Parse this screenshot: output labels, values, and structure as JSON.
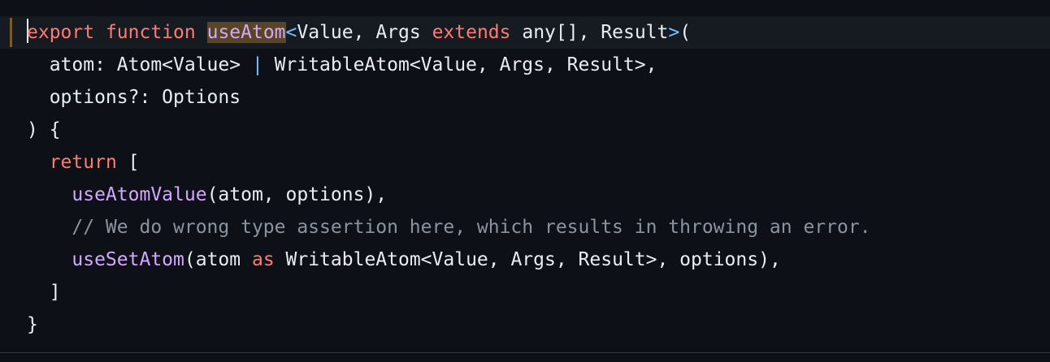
{
  "editor": {
    "lines": [
      {
        "tokens": [
          {
            "text": "export",
            "type": "keyword"
          },
          {
            "text": " ",
            "type": "plain"
          },
          {
            "text": "function",
            "type": "keyword"
          },
          {
            "text": " ",
            "type": "plain"
          },
          {
            "text": "useAtom",
            "type": "function-highlighted"
          },
          {
            "text": "<",
            "type": "operator"
          },
          {
            "text": "Value, Args ",
            "type": "plain"
          },
          {
            "text": "extends",
            "type": "keyword"
          },
          {
            "text": " any[], Result",
            "type": "plain"
          },
          {
            "text": ">",
            "type": "operator"
          },
          {
            "text": "(",
            "type": "plain"
          }
        ]
      },
      {
        "tokens": [
          {
            "text": "  atom: Atom<Value> ",
            "type": "plain"
          },
          {
            "text": "|",
            "type": "operator"
          },
          {
            "text": " WritableAtom<Value, Args, Result>,",
            "type": "plain"
          }
        ]
      },
      {
        "tokens": [
          {
            "text": "  options?: Options",
            "type": "plain"
          }
        ]
      },
      {
        "tokens": [
          {
            "text": ") {",
            "type": "plain"
          }
        ]
      },
      {
        "tokens": [
          {
            "text": "  ",
            "type": "plain"
          },
          {
            "text": "return",
            "type": "keyword"
          },
          {
            "text": " [",
            "type": "plain"
          }
        ]
      },
      {
        "tokens": [
          {
            "text": "    ",
            "type": "plain"
          },
          {
            "text": "useAtomValue",
            "type": "function"
          },
          {
            "text": "(atom, options),",
            "type": "plain"
          }
        ]
      },
      {
        "tokens": [
          {
            "text": "    // We do wrong type assertion here, which results in throwing an error.",
            "type": "comment"
          }
        ]
      },
      {
        "tokens": [
          {
            "text": "    ",
            "type": "plain"
          },
          {
            "text": "useSetAtom",
            "type": "function"
          },
          {
            "text": "(atom ",
            "type": "plain"
          },
          {
            "text": "as",
            "type": "keyword"
          },
          {
            "text": " WritableAtom<Value, Args, Result>, options),",
            "type": "plain"
          }
        ]
      },
      {
        "tokens": [
          {
            "text": "  ]",
            "type": "plain"
          }
        ]
      },
      {
        "tokens": [
          {
            "text": "}",
            "type": "plain"
          }
        ]
      }
    ]
  },
  "theme": {
    "background": "#0d1117",
    "keyword": "#ff7b72",
    "function": "#d2a8ff",
    "operator": "#79c0ff",
    "comment": "#8b949e",
    "text": "#e6edf3",
    "highlight": "#5a4523"
  }
}
